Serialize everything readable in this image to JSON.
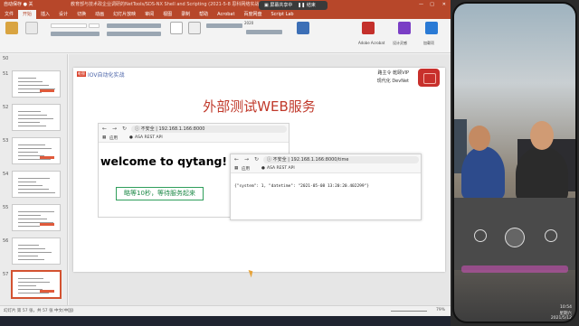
{
  "window": {
    "title": "教育部与技术政企业调研的NetTools/SDS-NX Shell and Scripting (2021-5-8 思科网络实战) - PowerPoint",
    "quick_access": "自动保存 ● 关"
  },
  "menu": [
    "文件",
    "开始",
    "插入",
    "设计",
    "切换",
    "动画",
    "幻灯片放映",
    "审阅",
    "视图",
    "录制",
    "帮助",
    "Acrobat",
    "百度网盘",
    "Script Lab"
  ],
  "menu_active_index": 1,
  "ribbon": {
    "groups": [
      "Adobe Acrobat",
      "设计灵感",
      "加载项"
    ],
    "labels": [
      "2020"
    ]
  },
  "screen_share": {
    "label": "屏幕共享中",
    "stop_label": "结束"
  },
  "thumbnails": {
    "numbers": [
      "51",
      "52",
      "53",
      "54",
      "55",
      "56",
      "57"
    ],
    "selected": "57",
    "prefix_top": "50"
  },
  "slide": {
    "badge": "乾颐",
    "course_title": "IOV自动化实战",
    "brand_line1": "路主令 乾颐VIP",
    "brand_line2": "现代化 DevNet",
    "title": "外部测试WEB服务"
  },
  "browser1": {
    "security": "不安全",
    "url": "192.168.1.166:8000",
    "bookmarks": [
      "应用",
      "ASA REST API"
    ],
    "heading": "welcome to qytang!"
  },
  "notice": "略等10秒，等待服务起来",
  "browser2": {
    "security": "不安全",
    "url": "192.168.1.166:8000/time",
    "bookmarks": [
      "应用",
      "ASA REST API"
    ],
    "json": "{\"system\": 1, \"datetime\": \"2021-05-08 13:20:20.402299\"}"
  },
  "statusbar": {
    "slide_info": "幻灯片 第 57 张，共 57 张",
    "lang": "中文(中国)",
    "zoom": "79%"
  },
  "phone": {
    "time": "10:54",
    "date": "星期六",
    "date2": "2021/5/12"
  },
  "colors": {
    "ppt_accent": "#b7472a",
    "title_red": "#c0392b",
    "notice_green": "#1e8a48"
  }
}
